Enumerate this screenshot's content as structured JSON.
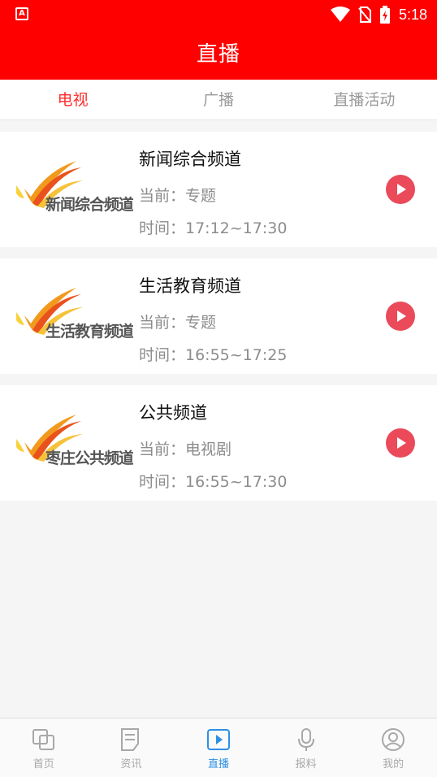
{
  "status_bar": {
    "left_icon": "A",
    "time": "5:18",
    "icons": [
      "wifi-icon",
      "no-sim-icon",
      "battery-charging-icon"
    ]
  },
  "header": {
    "title": "直播"
  },
  "tabs": [
    {
      "label": "电视",
      "active": true
    },
    {
      "label": "广播",
      "active": false
    },
    {
      "label": "直播活动",
      "active": false
    }
  ],
  "channels": [
    {
      "logo_text": "新闻综合频道",
      "name": "新闻综合频道",
      "current": "当前：专题",
      "time": "时间：17:12~17:30"
    },
    {
      "logo_text": "生活教育频道",
      "name": "生活教育频道",
      "current": "当前：专题",
      "time": "时间：16:55~17:25"
    },
    {
      "logo_text": "枣庄公共频道",
      "name": "公共频道",
      "current": "当前：电视剧",
      "time": "时间：16:55~17:30"
    }
  ],
  "bottom_nav": [
    {
      "label": "首页",
      "icon": "home-squares-icon",
      "active": false
    },
    {
      "label": "资讯",
      "icon": "news-doc-icon",
      "active": false
    },
    {
      "label": "直播",
      "icon": "live-play-icon",
      "active": true
    },
    {
      "label": "报料",
      "icon": "microphone-icon",
      "active": false
    },
    {
      "label": "我的",
      "icon": "user-icon",
      "active": false
    }
  ],
  "colors": {
    "header_red": "#ff0000",
    "active_tab": "#ff2b2b",
    "play_button": "#ea4a5a",
    "nav_active": "#2e8fe6"
  }
}
